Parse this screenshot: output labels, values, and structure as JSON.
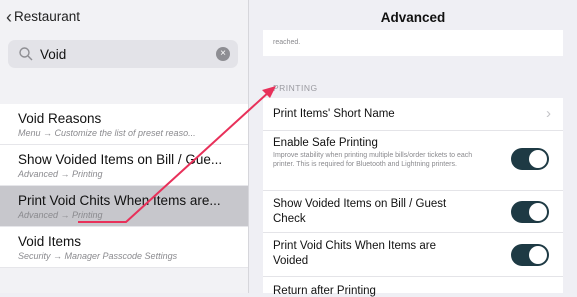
{
  "left": {
    "back_label": "Restaurant",
    "search_value": "Void",
    "results": [
      {
        "title": "Void Reasons",
        "subtitle": "Menu → Customize the list of preset reaso..."
      },
      {
        "title": "Show Voided Items on Bill / Gue...",
        "subtitle": "Advanced → Printing"
      },
      {
        "title": "Print Void Chits When Items are...",
        "subtitle": "Advanced → Printing"
      },
      {
        "title": "Void Items",
        "subtitle": "Security → Manager Passcode Settings"
      }
    ]
  },
  "right": {
    "title": "Advanced",
    "top_fragment": "reached.",
    "section_header": "PRINTING",
    "rows": [
      {
        "label": "Print Items' Short Name",
        "kind": "disclosure"
      },
      {
        "label": "Enable Safe Printing",
        "desc": "Improve stability when printing multiple bills/order tickets to each printer. This is required for Bluetooth and Lightning printers.",
        "kind": "toggle",
        "on": true
      },
      {
        "label": "Show Voided Items on Bill / Guest Check",
        "kind": "toggle",
        "on": true
      },
      {
        "label": "Print Void Chits When Items are Voided",
        "kind": "toggle",
        "on": true
      },
      {
        "label": "Return after Printing",
        "kind": "partial"
      }
    ]
  },
  "colors": {
    "toggle_on": "#1e3a44",
    "annotation_arrow": "#e8315a",
    "selected_row": "#c7c7cc"
  }
}
